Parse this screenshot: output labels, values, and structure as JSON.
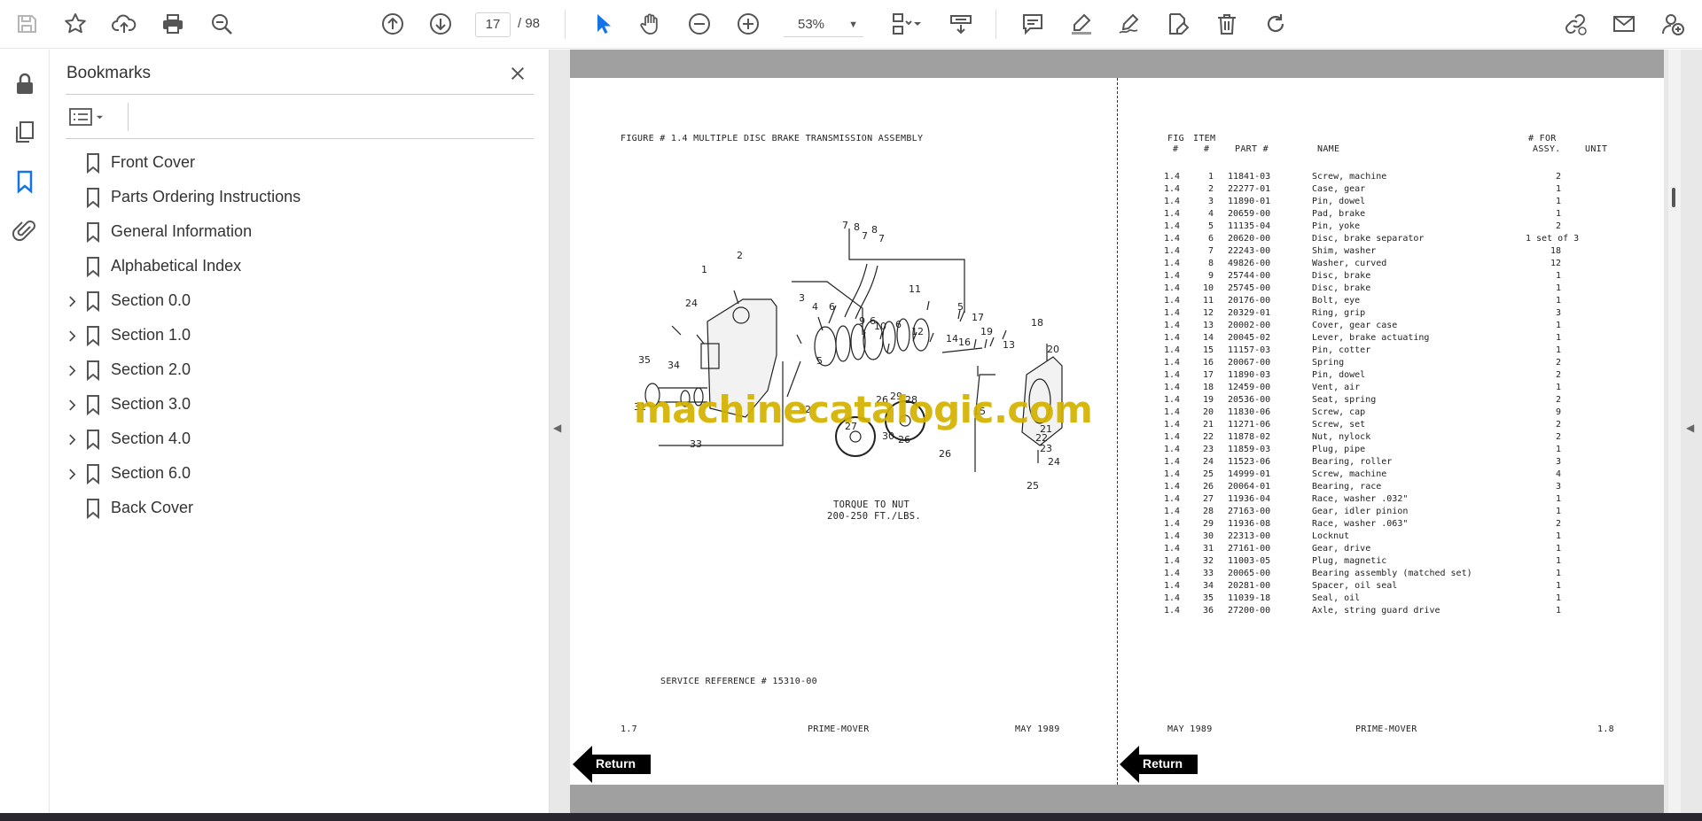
{
  "toolbar": {
    "left_icons": [
      "save-icon",
      "star-icon",
      "upload-icon",
      "print-icon",
      "zoom-search-icon"
    ],
    "nav": {
      "prev": "arrow-up-circle-icon",
      "next": "arrow-down-circle-icon"
    },
    "current_page": "17",
    "total_pages": "/ 98",
    "tools": [
      "select-pointer-icon",
      "hand-icon",
      "zoom-out-icon",
      "zoom-in-icon"
    ],
    "zoom_value": "53%",
    "right_icons": [
      "page-fit-icon",
      "scroll-mode-icon",
      "comment-icon",
      "highlight-icon",
      "sign-icon",
      "edit-pdf-icon",
      "delete-icon",
      "rotate-icon",
      "share-link-icon",
      "email-icon",
      "account-icon"
    ]
  },
  "left_rail": [
    "lock-icon",
    "pages-icon",
    "bookmark-icon",
    "attachment-icon"
  ],
  "bookmarks": {
    "title": "Bookmarks",
    "items": [
      {
        "label": "Front Cover",
        "expandable": false
      },
      {
        "label": "Parts Ordering Instructions",
        "expandable": false
      },
      {
        "label": "General Information",
        "expandable": false
      },
      {
        "label": "Alphabetical Index",
        "expandable": false
      },
      {
        "label": "Section 0.0",
        "expandable": true
      },
      {
        "label": "Section 1.0",
        "expandable": true
      },
      {
        "label": "Section 2.0",
        "expandable": true
      },
      {
        "label": "Section 3.0",
        "expandable": true
      },
      {
        "label": "Section 4.0",
        "expandable": true
      },
      {
        "label": "Section 6.0",
        "expandable": true
      },
      {
        "label": "Back Cover",
        "expandable": false
      }
    ]
  },
  "document": {
    "left_page": {
      "figure_title": "FIGURE # 1.4 MULTIPLE DISC BRAKE TRANSMISSION ASSEMBLY",
      "torque_note_1": "TORQUE TO NUT",
      "torque_note_2": "200-250 FT./LBS.",
      "service_ref": "SERVICE REFERENCE # 15310-00",
      "footer_page": "1.7",
      "footer_title": "PRIME-MOVER",
      "footer_date": "MAY 1989",
      "diagram_labels": [
        "7",
        "8",
        "7",
        "8",
        "7",
        "2",
        "1",
        "24",
        "3",
        "4",
        "6",
        "9",
        "6",
        "10",
        "6",
        "12",
        "11",
        "5",
        "19",
        "17",
        "16",
        "14",
        "13",
        "18",
        "20",
        "35",
        "34",
        "5",
        "26",
        "29",
        "28",
        "15",
        "21",
        "22",
        "23",
        "30",
        "27",
        "26",
        "26",
        "24",
        "25",
        "33",
        "31",
        "32"
      ]
    },
    "right_page": {
      "headers": {
        "fig": "FIG",
        "fig_hash": "#",
        "item": "ITEM",
        "item_hash": "#",
        "part": "PART #",
        "name": "NAME",
        "for": "# FOR",
        "assy": "ASSY.",
        "unit": "UNIT"
      },
      "rows": [
        {
          "fig": "1.4",
          "item": "1",
          "part": "11841-03",
          "name": "Screw, machine",
          "qty": "2"
        },
        {
          "fig": "1.4",
          "item": "2",
          "part": "22277-01",
          "name": "Case, gear",
          "qty": "1"
        },
        {
          "fig": "1.4",
          "item": "3",
          "part": "11890-01",
          "name": "Pin, dowel",
          "qty": "1"
        },
        {
          "fig": "1.4",
          "item": "4",
          "part": "20659-00",
          "name": "Pad, brake",
          "qty": "1"
        },
        {
          "fig": "1.4",
          "item": "5",
          "part": "11135-04",
          "name": "Pin, yoke",
          "qty": "2"
        },
        {
          "fig": "1.4",
          "item": "6",
          "part": "20620-00",
          "name": "Disc, brake separator",
          "qty": "1 set of 3"
        },
        {
          "fig": "1.4",
          "item": "7",
          "part": "22243-00",
          "name": "Shim, washer",
          "qty": "18"
        },
        {
          "fig": "1.4",
          "item": "8",
          "part": "49826-00",
          "name": "Washer, curved",
          "qty": "12"
        },
        {
          "fig": "1.4",
          "item": "9",
          "part": "25744-00",
          "name": "Disc, brake",
          "qty": "1"
        },
        {
          "fig": "1.4",
          "item": "10",
          "part": "25745-00",
          "name": "Disc, brake",
          "qty": "1"
        },
        {
          "fig": "1.4",
          "item": "11",
          "part": "20176-00",
          "name": "Bolt, eye",
          "qty": "1"
        },
        {
          "fig": "1.4",
          "item": "12",
          "part": "20329-01",
          "name": "Ring, grip",
          "qty": "3"
        },
        {
          "fig": "1.4",
          "item": "13",
          "part": "20002-00",
          "name": "Cover, gear case",
          "qty": "1"
        },
        {
          "fig": "1.4",
          "item": "14",
          "part": "20045-02",
          "name": "Lever, brake actuating",
          "qty": "1"
        },
        {
          "fig": "1.4",
          "item": "15",
          "part": "11157-03",
          "name": "Pin, cotter",
          "qty": "1"
        },
        {
          "fig": "1.4",
          "item": "16",
          "part": "20067-00",
          "name": "Spring",
          "qty": "2"
        },
        {
          "fig": "1.4",
          "item": "17",
          "part": "11890-03",
          "name": "Pin, dowel",
          "qty": "2"
        },
        {
          "fig": "1.4",
          "item": "18",
          "part": "12459-00",
          "name": "Vent, air",
          "qty": "1"
        },
        {
          "fig": "1.4",
          "item": "19",
          "part": "20536-00",
          "name": "Seat, spring",
          "qty": "2"
        },
        {
          "fig": "1.4",
          "item": "20",
          "part": "11830-06",
          "name": "Screw, cap",
          "qty": "9"
        },
        {
          "fig": "1.4",
          "item": "21",
          "part": "11271-06",
          "name": "Screw, set",
          "qty": "2"
        },
        {
          "fig": "1.4",
          "item": "22",
          "part": "11878-02",
          "name": "Nut, nylock",
          "qty": "2"
        },
        {
          "fig": "1.4",
          "item": "23",
          "part": "11859-03",
          "name": "Plug, pipe",
          "qty": "1"
        },
        {
          "fig": "1.4",
          "item": "24",
          "part": "11523-06",
          "name": "Bearing, roller",
          "qty": "3"
        },
        {
          "fig": "1.4",
          "item": "25",
          "part": "14999-01",
          "name": "Screw, machine",
          "qty": "4"
        },
        {
          "fig": "1.4",
          "item": "26",
          "part": "20064-01",
          "name": "Bearing, race",
          "qty": "3"
        },
        {
          "fig": "1.4",
          "item": "27",
          "part": "11936-04",
          "name": "Race, washer .032\"",
          "qty": "1"
        },
        {
          "fig": "1.4",
          "item": "28",
          "part": "27163-00",
          "name": "Gear, idler pinion",
          "qty": "1"
        },
        {
          "fig": "1.4",
          "item": "29",
          "part": "11936-08",
          "name": "Race, washer .063\"",
          "qty": "2"
        },
        {
          "fig": "1.4",
          "item": "30",
          "part": "22313-00",
          "name": "Locknut",
          "qty": "1"
        },
        {
          "fig": "1.4",
          "item": "31",
          "part": "27161-00",
          "name": "Gear, drive",
          "qty": "1"
        },
        {
          "fig": "1.4",
          "item": "32",
          "part": "11003-05",
          "name": "Plug, magnetic",
          "qty": "1"
        },
        {
          "fig": "1.4",
          "item": "33",
          "part": "20065-00",
          "name": "Bearing assembly (matched set)",
          "qty": "1"
        },
        {
          "fig": "1.4",
          "item": "34",
          "part": "20281-00",
          "name": "Spacer, oil seal",
          "qty": "1"
        },
        {
          "fig": "1.4",
          "item": "35",
          "part": "11039-18",
          "name": "Seal, oil",
          "qty": "1"
        },
        {
          "fig": "1.4",
          "item": "36",
          "part": "27200-00",
          "name": "Axle, string guard drive",
          "qty": "1"
        }
      ],
      "footer_date": "MAY 1989",
      "footer_title": "PRIME-MOVER",
      "footer_page": "1.8"
    },
    "return_label": "Return",
    "watermark": "machinecatalogic.com"
  },
  "colors": {
    "accent_blue": "#1473e6",
    "watermark": "#d4b300",
    "page_strip": "#a0a0a0"
  }
}
